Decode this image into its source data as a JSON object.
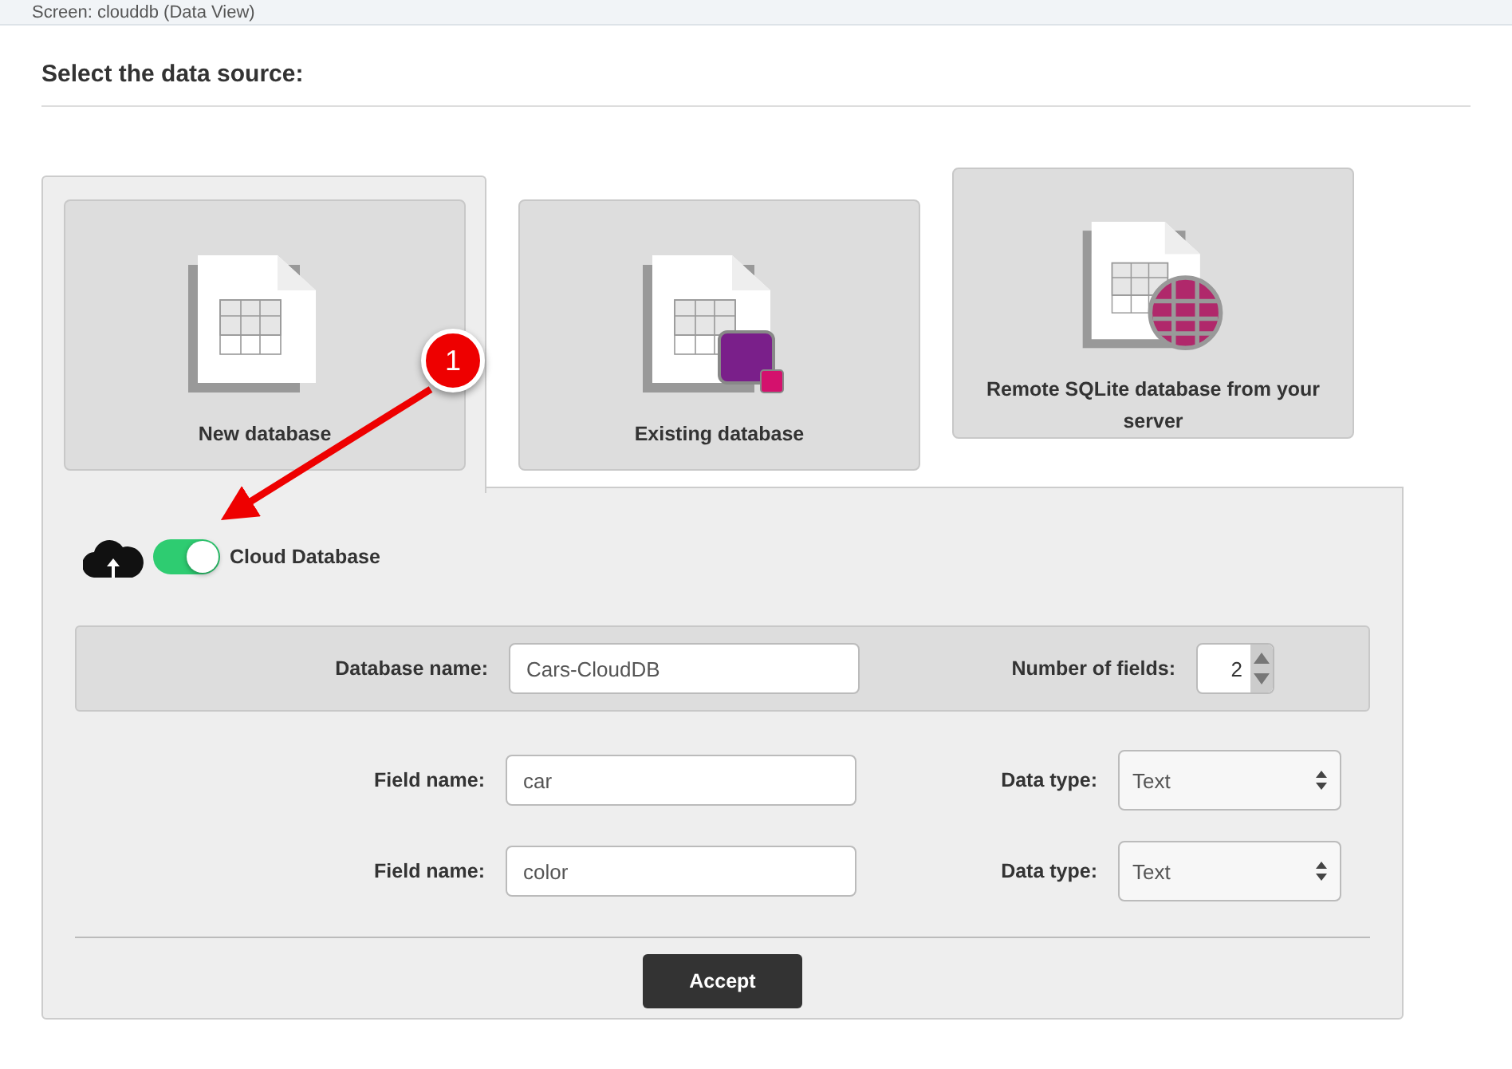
{
  "screen_title": "Screen: clouddb (Data View)",
  "heading": "Select the data source:",
  "sources": [
    {
      "label": "New database",
      "kind": "new",
      "selected": true
    },
    {
      "label": "Existing database",
      "kind": "existing",
      "selected": false
    },
    {
      "label": "Remote SQLite database from your server",
      "kind": "remote",
      "selected": false
    }
  ],
  "cloud_toggle": {
    "label": "Cloud Database",
    "on": true
  },
  "database": {
    "name_label": "Database name:",
    "name_value": "Cars-CloudDB",
    "count_label": "Number of fields:",
    "count_value": "2"
  },
  "fields": [
    {
      "name_label": "Field name:",
      "name_value": "car",
      "type_label": "Data type:",
      "type_value": "Text"
    },
    {
      "name_label": "Field name:",
      "name_value": "color",
      "type_label": "Data type:",
      "type_value": "Text"
    }
  ],
  "accept_button": "Accept",
  "annotation": {
    "number": "1"
  }
}
